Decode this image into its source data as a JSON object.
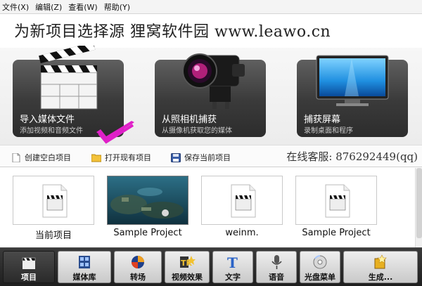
{
  "menu": [
    {
      "label": "文件(X)"
    },
    {
      "label": "编辑(Z)"
    },
    {
      "label": "查看(W)"
    },
    {
      "label": "帮助(Y)"
    }
  ],
  "page_title": "为新项目选择源 狸窝软件园 www.leawo.cn",
  "cards": [
    {
      "title": "导入媒体文件",
      "sub": "添加视频和音频文件",
      "icon": "clapperboard-icon"
    },
    {
      "title": "从照相机捕获",
      "sub": "从摄像机获取您的媒体",
      "icon": "camcorder-icon"
    },
    {
      "title": "捕获屏幕",
      "sub": "录制桌面和程序",
      "icon": "monitor-icon"
    }
  ],
  "actions": [
    {
      "label": "创建空白项目",
      "icon": "blank-document-icon"
    },
    {
      "label": "打开现有项目",
      "icon": "folder-icon"
    },
    {
      "label": "保存当前项目",
      "icon": "floppy-disk-icon"
    }
  ],
  "support_text": "在线客服: 876292449(qq)",
  "projects": [
    {
      "label": "当前项目",
      "thumb": "clapperboard-icon"
    },
    {
      "label": "Sample Project",
      "thumb": "underwater-photo"
    },
    {
      "label": "weinm.",
      "thumb": "clapperboard-icon"
    },
    {
      "label": "Sample Project",
      "thumb": "clapperboard-icon"
    }
  ],
  "toolbar": [
    {
      "label": "项目",
      "icon": "clapperboard-icon",
      "active": true
    },
    {
      "label": "媒体库",
      "icon": "film-library-icon"
    },
    {
      "label": "转场",
      "icon": "transition-icon"
    },
    {
      "label": "视频效果",
      "icon": "video-effects-icon"
    },
    {
      "label": "文字",
      "icon": "text-icon"
    },
    {
      "label": "语音",
      "icon": "microphone-icon"
    },
    {
      "label": "光盘菜单",
      "icon": "disc-menu-icon"
    },
    {
      "label": "生成...",
      "icon": "produce-icon"
    }
  ],
  "colors": {
    "accent_check": "#e020c8",
    "card_dark": "#3b3b3b",
    "toolbar_dark": "#2a2a2a"
  }
}
